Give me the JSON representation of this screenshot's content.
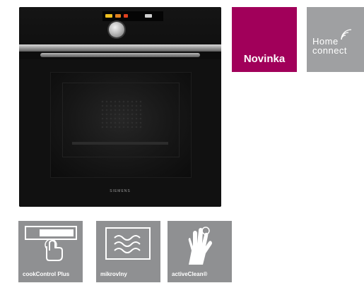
{
  "product": {
    "image_name": "built-in-oven",
    "brand_plate": "SIEMENS"
  },
  "badges": {
    "new": {
      "label": "Novinka",
      "color": "#a1005a"
    },
    "home_connect": {
      "line1": "Home",
      "line2": "connect",
      "color": "#9fa0a2",
      "icon": "wifi-signal-icon"
    }
  },
  "features": [
    {
      "label": "cookControl Plus",
      "icon": "touch-panel-icon"
    },
    {
      "label": "mikrovlny",
      "icon": "microwave-waves-icon"
    },
    {
      "label": "activeClean®",
      "icon": "cleaning-glove-icon"
    }
  ]
}
